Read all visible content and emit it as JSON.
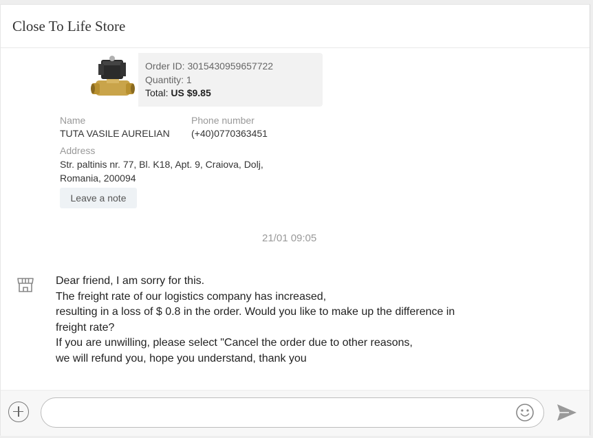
{
  "header": {
    "store_name": "Close To Life Store"
  },
  "order": {
    "product_image_icon": "solenoid-valve-product-image",
    "id_label": "Order ID:",
    "id_value": "3015430959657722",
    "quantity_label": "Quantity:",
    "quantity_value": "1",
    "total_label": "Total:",
    "total_value": "US $9.85"
  },
  "shipping": {
    "name_label": "Name",
    "name_value": "TUTA VASILE AURELIAN",
    "phone_label": "Phone number",
    "phone_value": "(+40)0770363451",
    "address_label": "Address",
    "address_line1": "Str. paltinis nr. 77, Bl. K18, Apt. 9, Craiova, Dolj,",
    "address_line2": "Romania, 200094",
    "note_button": "Leave a note"
  },
  "chat": {
    "timestamp": "21/01 09:05",
    "avatar_icon": "store-icon",
    "message_lines": [
      "Dear friend, I am sorry for this.",
      "The freight rate of our logistics company has increased,",
      "resulting in a loss of $ 0.8 in the order. Would you like to make up the difference in",
      "freight rate?",
      "If you are unwilling, please select \"Cancel the order due to other reasons,",
      "we will refund you, hope you understand, thank you"
    ]
  },
  "composer": {
    "placeholder": "",
    "plus_icon": "plus-circle-icon",
    "emoji_icon": "smiley-icon",
    "send_icon": "send-icon"
  }
}
